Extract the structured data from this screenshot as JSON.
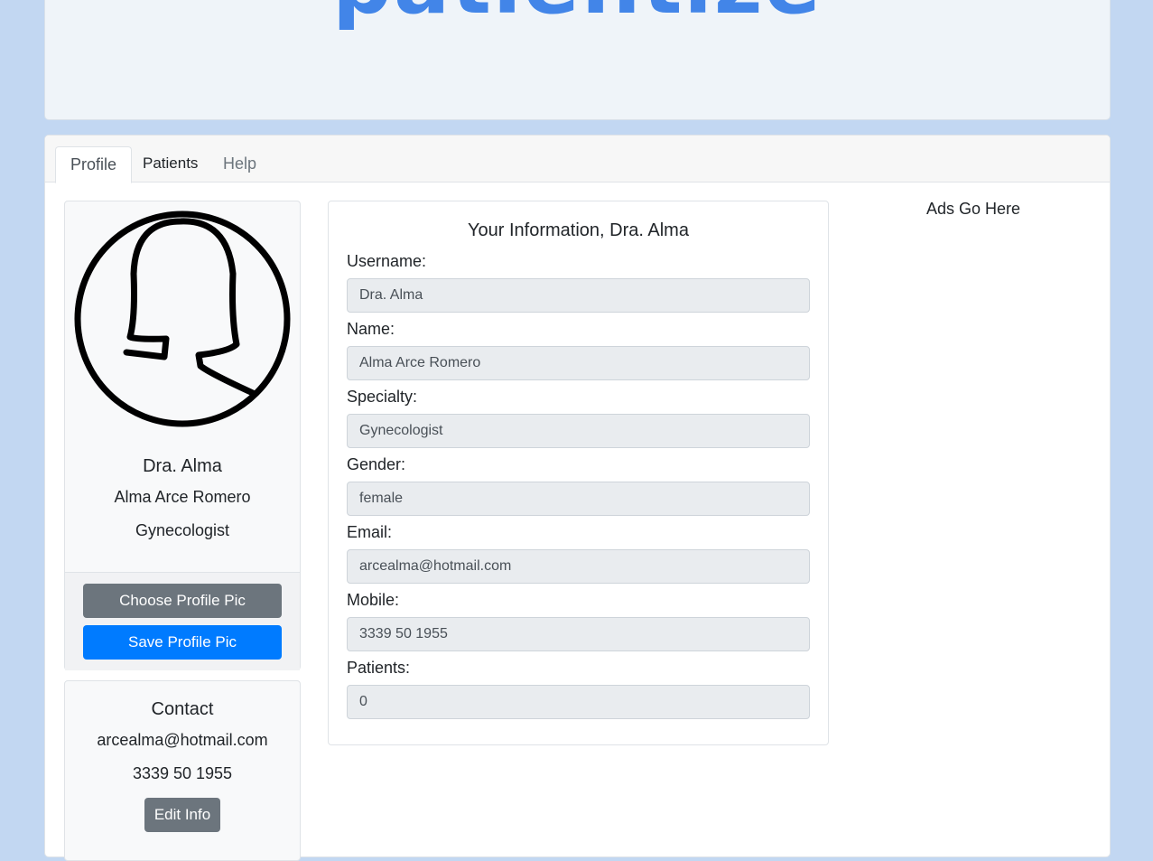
{
  "banner": {
    "logo_text": "patientize"
  },
  "tabs": [
    {
      "label": "Profile"
    },
    {
      "label": "Patients"
    },
    {
      "label": "Help"
    }
  ],
  "profile": {
    "display_name": "Dra. Alma",
    "full_name": "Alma Arce Romero",
    "specialty": "Gynecologist",
    "choose_pic_label": "Choose Profile Pic",
    "save_pic_label": "Save Profile Pic"
  },
  "contact": {
    "heading": "Contact",
    "email": "arcealma@hotmail.com",
    "phone": "3339 50 1955",
    "edit_label": "Edit Info"
  },
  "info": {
    "heading": "Your Information, Dra. Alma",
    "fields": [
      {
        "label": "Username:",
        "value": "Dra. Alma"
      },
      {
        "label": "Name:",
        "value": "Alma Arce Romero"
      },
      {
        "label": "Specialty:",
        "value": "Gynecologist"
      },
      {
        "label": "Gender:",
        "value": "female"
      },
      {
        "label": "Email:",
        "value": "arcealma@hotmail.com"
      },
      {
        "label": "Mobile:",
        "value": "3339 50 1955"
      },
      {
        "label": "Patients:",
        "value": "0"
      }
    ]
  },
  "ads": {
    "text": "Ads Go Here"
  },
  "colors": {
    "page_bg": "#c2d7f2",
    "brand": "#4285e8",
    "primary": "#007bff",
    "secondary": "#6c757d"
  }
}
